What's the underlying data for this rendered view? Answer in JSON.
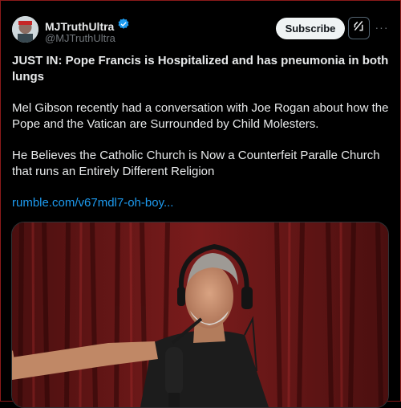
{
  "author": {
    "display_name": "MJTruthUltra",
    "handle": "@MJTruthUltra",
    "verified": true,
    "verified_color": "#1d9bf0"
  },
  "actions": {
    "subscribe_label": "Subscribe",
    "grok_icon": "grok-icon",
    "more_icon": "more-icon",
    "more_label": "···"
  },
  "post": {
    "headline": "JUST IN: Pope Francis is Hospitalized and has pneumonia in both lungs",
    "paragraph_1": "Mel Gibson recently had a conversation with Joe Rogan about how the Pope and the Vatican are Surrounded by Child Molesters.",
    "paragraph_2": "He Believes the Catholic Church is Now a Counterfeit Paralle Church that runs an Entirely Different Religion",
    "link_text": "rumble.com/v67mdl7-oh-boy..."
  },
  "colors": {
    "background": "#000000",
    "text": "#e7e9ea",
    "muted": "#71767b",
    "link": "#1d9bf0",
    "curtain": "#6b1a1a"
  }
}
